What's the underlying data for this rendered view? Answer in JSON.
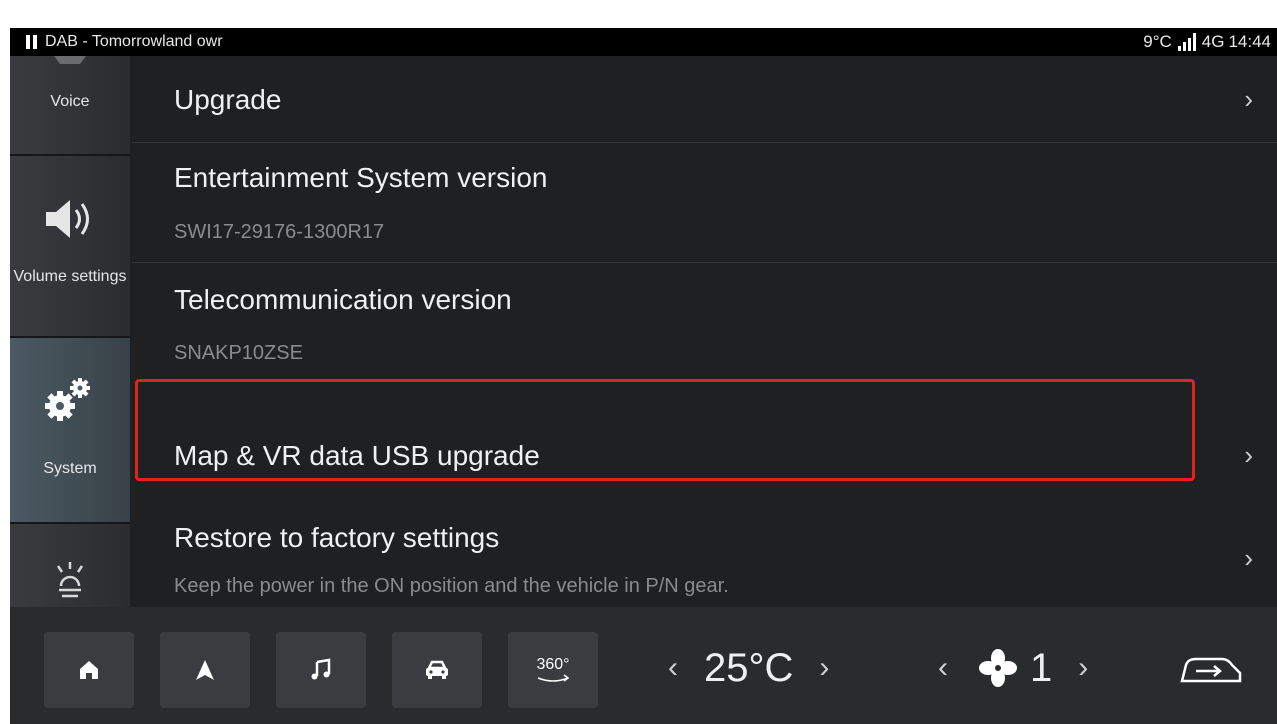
{
  "status_bar": {
    "source": "DAB - Tomorrowland owr",
    "temperature": "9°C",
    "network": "4G",
    "time": "14:44"
  },
  "sidebar": {
    "items": [
      {
        "label": "Voice",
        "icon": "voice-icon"
      },
      {
        "label": "Volume settings",
        "icon": "speaker-icon"
      },
      {
        "label": "System",
        "icon": "gears-icon",
        "active": true
      },
      {
        "label": "",
        "icon": "light-bulb-icon"
      }
    ]
  },
  "main": {
    "rows": [
      {
        "title": "Upgrade",
        "chevron": "›"
      },
      {
        "title": "Entertainment System version",
        "subtitle": "SWI17-29176-1300R17"
      },
      {
        "title": "Telecommunication version",
        "subtitle": "SNAKP10ZSE"
      },
      {
        "title": "Map & VR data USB upgrade",
        "chevron": "›",
        "highlighted": true
      },
      {
        "title": "Restore to factory settings",
        "subtitle": "Keep the power in the ON position and the vehicle in P/N gear.",
        "chevron": "›"
      }
    ]
  },
  "dock": {
    "buttons": [
      {
        "name": "home",
        "icon": "home-icon"
      },
      {
        "name": "navigation",
        "icon": "navigation-arrow-icon"
      },
      {
        "name": "music",
        "icon": "music-note-icon"
      },
      {
        "name": "car",
        "icon": "car-icon"
      },
      {
        "name": "360",
        "label": "360°",
        "icon": "camera-360-icon"
      }
    ],
    "temperature": "25°C",
    "fan_speed": "1",
    "left_arrow": "‹",
    "right_arrow": "›"
  },
  "colors": {
    "highlight_border": "#e0241b",
    "background": "#1f2022",
    "active_sidebar": "#4a5a63"
  }
}
